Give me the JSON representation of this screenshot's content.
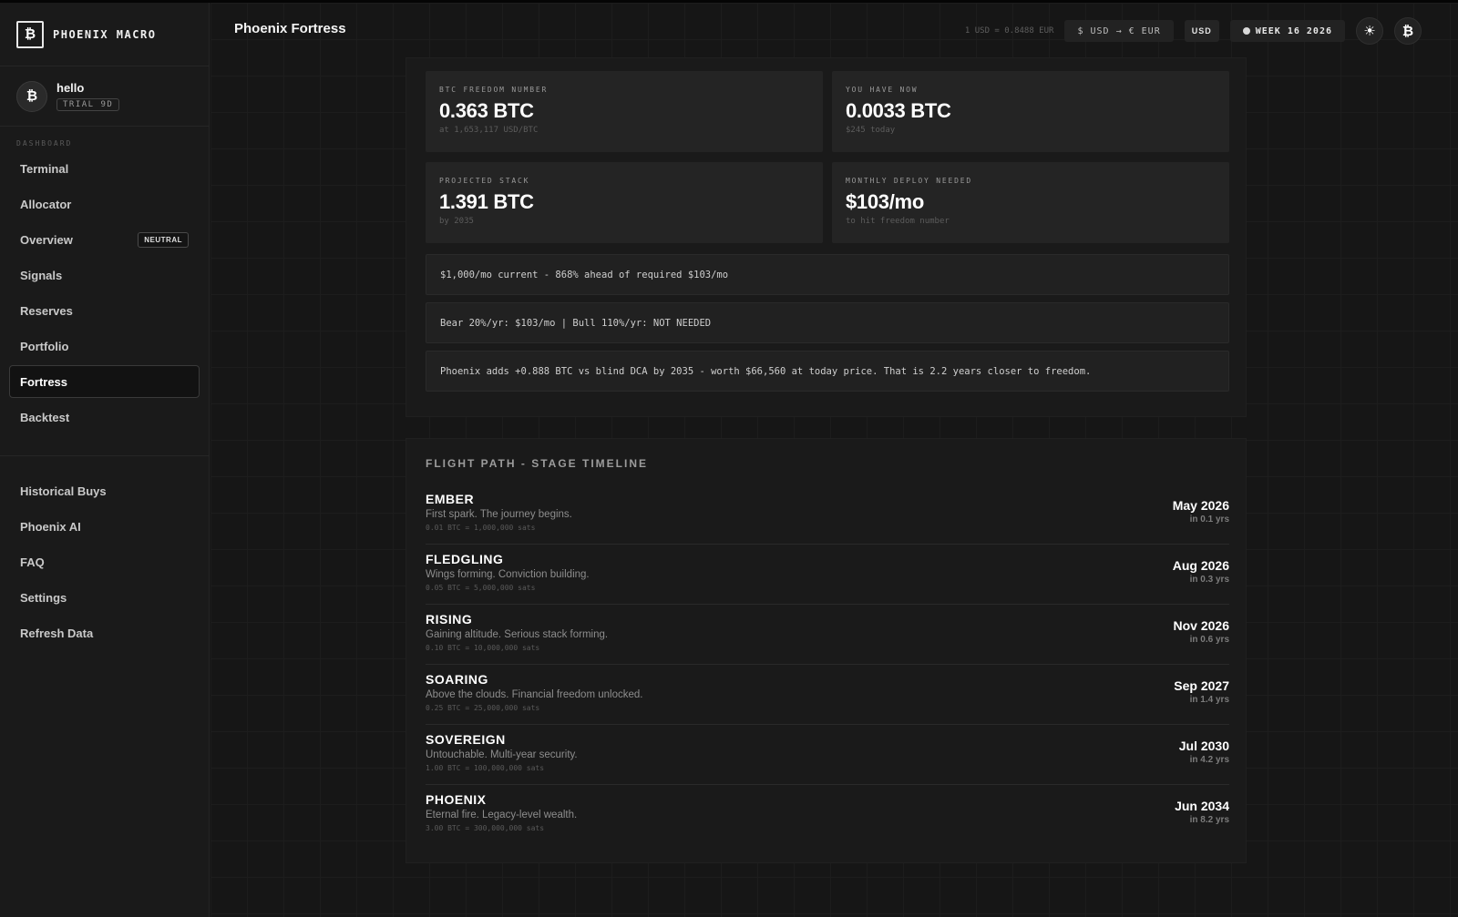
{
  "brand": {
    "logo_glyph": "₿",
    "name": "PHOENIX MACRO"
  },
  "user": {
    "avatar_glyph": "₿",
    "name": "hello",
    "trial": "TRIAL 9D"
  },
  "sidebar": {
    "section_label": "DASHBOARD",
    "items": [
      {
        "label": "Terminal"
      },
      {
        "label": "Allocator"
      },
      {
        "label": "Overview",
        "badge": "NEUTRAL"
      },
      {
        "label": "Signals"
      },
      {
        "label": "Reserves"
      },
      {
        "label": "Portfolio"
      },
      {
        "label": "Fortress",
        "active": true
      },
      {
        "label": "Backtest"
      }
    ],
    "secondary": [
      {
        "label": "Historical Buys"
      },
      {
        "label": "Phoenix AI"
      },
      {
        "label": "FAQ"
      },
      {
        "label": "Settings"
      },
      {
        "label": "Refresh Data"
      }
    ]
  },
  "header": {
    "title": "Phoenix Fortress",
    "fx_rate": "1 USD = 0.8488 EUR",
    "convert_label": "$ USD → € EUR",
    "currency": "USD",
    "week": "WEEK 16 2026",
    "theme_icon": "sun-icon",
    "theme_glyph": "☀",
    "btc_glyph": "₿"
  },
  "stats": {
    "freedom": {
      "label": "BTC FREEDOM NUMBER",
      "value": "0.363 BTC",
      "sub": "at 1,653,117 USD/BTC"
    },
    "have": {
      "label": "YOU HAVE NOW",
      "value": "0.0033 BTC",
      "sub": "$245 today"
    },
    "projected": {
      "label": "PROJECTED STACK",
      "value": "1.391 BTC",
      "sub": "by 2035"
    },
    "monthly": {
      "label": "MONTHLY DEPLOY NEEDED",
      "value": "$103/mo",
      "sub": "to hit freedom number"
    }
  },
  "notes": {
    "current": "$1,000/mo current - 868% ahead of required $103/mo",
    "scenarios": "Bear 20%/yr: $103/mo | Bull 110%/yr: NOT NEEDED",
    "phoenix": "Phoenix adds +0.888 BTC vs blind DCA by 2035 - worth $66,560 at today price. That is 2.2 years closer to freedom."
  },
  "timeline": {
    "title": "FLIGHT PATH - STAGE TIMELINE",
    "stages": [
      {
        "name": "EMBER",
        "desc": "First spark. The journey begins.",
        "sats": "0.01 BTC = 1,000,000 sats",
        "date": "May 2026",
        "eta": "in 0.1 yrs"
      },
      {
        "name": "FLEDGLING",
        "desc": "Wings forming. Conviction building.",
        "sats": "0.05 BTC = 5,000,000 sats",
        "date": "Aug 2026",
        "eta": "in 0.3 yrs"
      },
      {
        "name": "RISING",
        "desc": "Gaining altitude. Serious stack forming.",
        "sats": "0.10 BTC = 10,000,000 sats",
        "date": "Nov 2026",
        "eta": "in 0.6 yrs"
      },
      {
        "name": "SOARING",
        "desc": "Above the clouds. Financial freedom unlocked.",
        "sats": "0.25 BTC = 25,000,000 sats",
        "date": "Sep 2027",
        "eta": "in 1.4 yrs"
      },
      {
        "name": "SOVEREIGN",
        "desc": "Untouchable. Multi-year security.",
        "sats": "1.00 BTC = 100,000,000 sats",
        "date": "Jul 2030",
        "eta": "in 4.2 yrs"
      },
      {
        "name": "PHOENIX",
        "desc": "Eternal fire. Legacy-level wealth.",
        "sats": "3.00 BTC = 300,000,000 sats",
        "date": "Jun 2034",
        "eta": "in 8.2 yrs"
      }
    ]
  }
}
